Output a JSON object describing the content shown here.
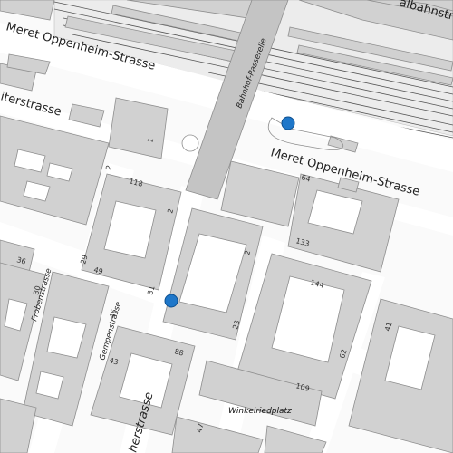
{
  "map": {
    "colors": {
      "street": "#ffffff",
      "block": "#ffffff",
      "building": "#d1d1d1",
      "building_outline": "#8e8e8e",
      "rail_area": "#ececec",
      "bridge": "#c4c4c4",
      "marker": "#1f77c9",
      "marker_outline": "#0d4f8f"
    },
    "streets": {
      "meret_oppenheim_left": "Meret Oppenheim-Strasse",
      "meret_oppenheim_right": "Meret Oppenheim-Strasse",
      "bahnhof_passerelle": "Bahnhof-Passerelle",
      "top_right_partial": "albahnstrasse",
      "left_partial": "iterstrasse",
      "frobenstrasse": "Frobenstrasse",
      "gempenstrasse": "Gempenstrasse",
      "bottom_partial": "herstrasse"
    },
    "places": {
      "winkelriedplatz": "Winkelriedplatz"
    },
    "house_numbers": {
      "n1": "1",
      "n2a": "2",
      "n2b": "2",
      "n2c": "2",
      "n118": "118",
      "n29": "29",
      "n49": "49",
      "n36": "36",
      "n30": "30",
      "n46": "46",
      "n43": "43",
      "n31": "31",
      "n88": "88",
      "n64": "64",
      "n133": "133",
      "n144": "144",
      "n23": "23",
      "n109": "109",
      "n62": "62",
      "n41": "41",
      "n47": "47"
    },
    "markers": [
      {
        "name": "location-marker-north"
      },
      {
        "name": "location-marker-west"
      }
    ]
  }
}
